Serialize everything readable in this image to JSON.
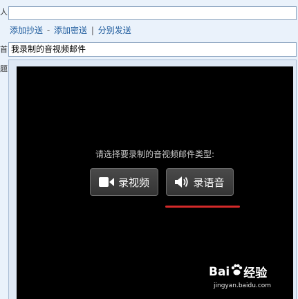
{
  "left_labels": [
    "人",
    "首",
    "题"
  ],
  "recipients": {
    "value": ""
  },
  "links": [
    "添加抄送",
    "添加密送",
    "分别发送"
  ],
  "link_separators": [
    "-",
    "|"
  ],
  "subject": {
    "value": "我录制的音视频邮件"
  },
  "recorder": {
    "prompt": "请选择要录制的音视频邮件类型:",
    "record_video_label": "录视频",
    "record_audio_label": "录语音"
  },
  "watermark": {
    "brand_left": "Bai",
    "brand_right": "经验",
    "url": "jingyan.baidu.com"
  },
  "colors": {
    "link": "#1c5a9c",
    "highlight": "#d42a2a",
    "recorder_bg": "#000000"
  }
}
